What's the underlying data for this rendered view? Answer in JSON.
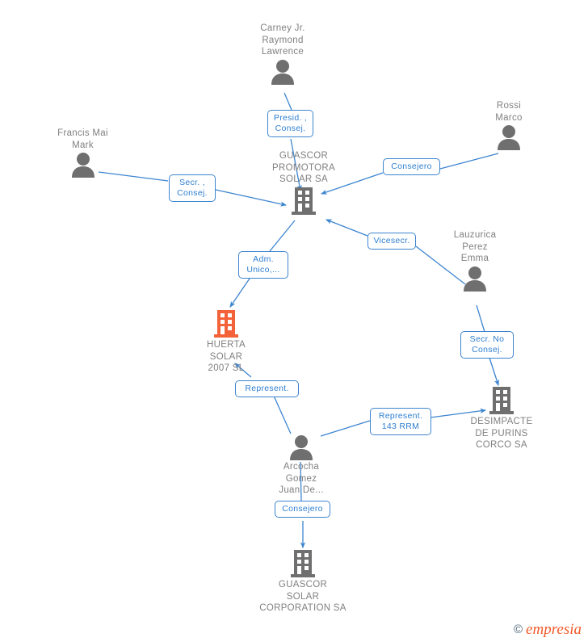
{
  "diagram": {
    "type": "corporate-relationship-network",
    "background_color": "#ffffff",
    "node_gray": "#6f6f6f",
    "node_highlight": "#f4623a",
    "edge_color": "#3d85d0",
    "label_text_color": "#2f7fd1",
    "node_text_color": "#808080"
  },
  "nodes": [
    {
      "id": "carney",
      "name": "Carney Jr.\nRaymond\nLawrence",
      "icon": "person-icon",
      "kind": "person",
      "label_position": "above"
    },
    {
      "id": "francis",
      "name": "Francis Mai\nMark",
      "icon": "person-icon",
      "kind": "person",
      "label_position": "above"
    },
    {
      "id": "rossi",
      "name": "Rossi\nMarco",
      "icon": "person-icon",
      "kind": "person",
      "label_position": "above"
    },
    {
      "id": "lauzurica",
      "name": "Lauzurica\nPerez\nEmma",
      "icon": "person-icon",
      "kind": "person",
      "label_position": "above"
    },
    {
      "id": "arcocha",
      "name": "Arcocha\nGomez\nJuan De...",
      "icon": "person-icon",
      "kind": "person",
      "label_position": "below"
    },
    {
      "id": "guascor_promotora",
      "name": "GUASCOR\nPROMOTORA\nSOLAR SA",
      "icon": "company-building-icon",
      "kind": "company",
      "label_position": "above"
    },
    {
      "id": "huerta_solar",
      "name": "HUERTA\nSOLAR\n2007 SL",
      "icon": "company-building-icon-highlighted",
      "kind": "company",
      "label_position": "below",
      "highlighted": true
    },
    {
      "id": "desimpacte",
      "name": "DESIMPACTE\nDE PURINS\nCORCO SA",
      "icon": "company-building-icon",
      "kind": "company",
      "label_position": "below"
    },
    {
      "id": "guascor_corporation",
      "name": "GUASCOR\nSOLAR\nCORPORATION SA",
      "icon": "company-building-icon",
      "kind": "company",
      "label_position": "below"
    }
  ],
  "edges": [
    {
      "id": "e1",
      "from": "carney",
      "to": "guascor_promotora",
      "label": "Presid. ,\nConsej."
    },
    {
      "id": "e2",
      "from": "francis",
      "to": "guascor_promotora",
      "label": "Secr. ,\nConsej."
    },
    {
      "id": "e3",
      "from": "rossi",
      "to": "guascor_promotora",
      "label": "Consejero"
    },
    {
      "id": "e4",
      "from": "lauzurica",
      "to": "guascor_promotora",
      "label": "Vicesecr."
    },
    {
      "id": "e5",
      "from": "guascor_promotora",
      "to": "huerta_solar",
      "label": "Adm.\nUnico,..."
    },
    {
      "id": "e6",
      "from": "arcocha",
      "to": "huerta_solar",
      "label": "Represent."
    },
    {
      "id": "e7",
      "from": "arcocha",
      "to": "desimpacte",
      "label": "Represent.\n143 RRM"
    },
    {
      "id": "e8",
      "from": "lauzurica",
      "to": "desimpacte",
      "label": "Secr.  No\nConsej."
    },
    {
      "id": "e9",
      "from": "arcocha",
      "to": "guascor_corporation",
      "label": "Consejero"
    }
  ],
  "watermark": {
    "copyright_symbol": "©",
    "brand": "empresia"
  }
}
